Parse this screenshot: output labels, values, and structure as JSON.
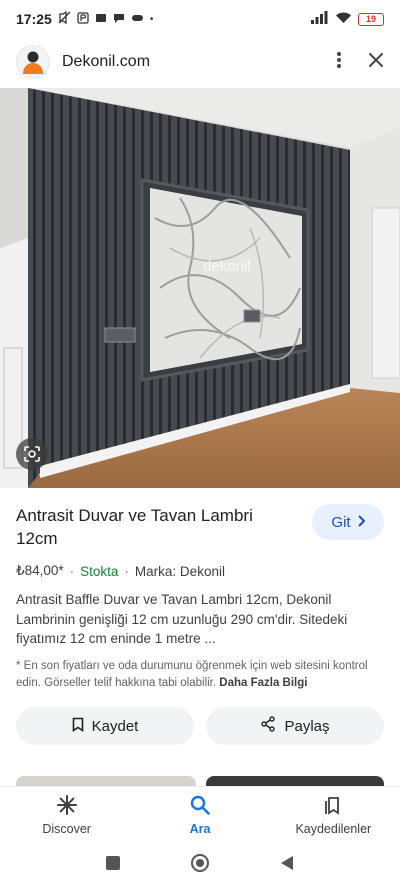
{
  "status_bar": {
    "time": "17:25",
    "battery": "19"
  },
  "header": {
    "site_name": "Dekonil.com"
  },
  "hero": {
    "watermark": "dekonil"
  },
  "product": {
    "title": "Antrasit Duvar ve Tavan Lambri 12cm",
    "price": "₺84,00*",
    "stock": "Stokta",
    "brand": "Marka: Dekonil",
    "description": "Antrasit Baffle Duvar ve Tavan Lambri 12cm, Dekonil Lambrinin genişliği 12 cm uzunluğu 290 cm'dir. Sitedeki fiyatımız 12 cm eninde 1 metre ...",
    "note": "* En son fiyatları ve oda durumunu öğrenmek için web sitesini kontrol edin. Görseller telif hakkına tabi olabilir.",
    "more_info": "Daha Fazla Bilgi"
  },
  "buttons": {
    "git": "Git",
    "save": "Kaydet",
    "share": "Paylaş"
  },
  "bottom_nav": {
    "items": [
      {
        "label": "Discover",
        "icon": "asterisk-icon"
      },
      {
        "label": "Ara",
        "icon": "search-icon",
        "active": true
      },
      {
        "label": "Kaydedilenler",
        "icon": "bookmarks-icon"
      }
    ]
  },
  "colors": {
    "accent": "#1a73e8",
    "stock_green": "#188038",
    "git_bg": "#e8f0fe"
  }
}
